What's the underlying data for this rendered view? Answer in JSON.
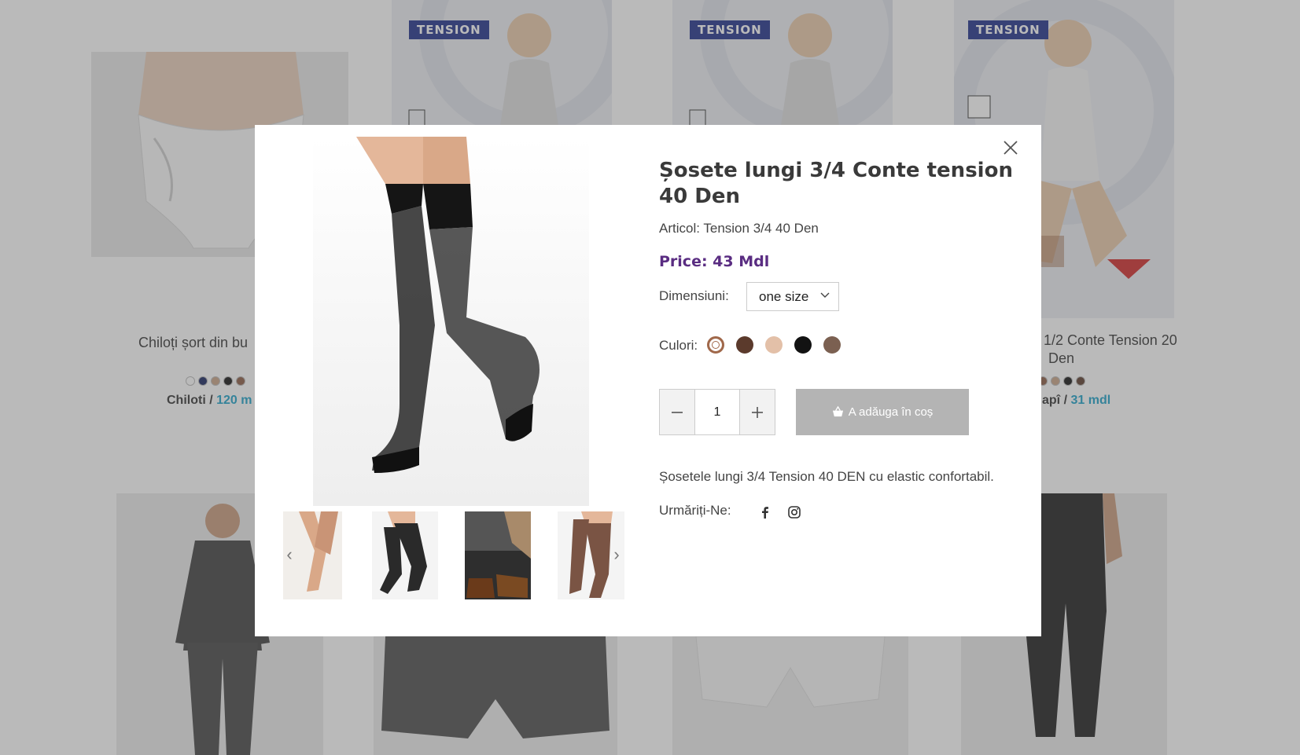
{
  "background": {
    "products": [
      {
        "title": "Chiloți șort din bu",
        "category": "Chiloti",
        "price": "120 m",
        "swatch_colors": [
          "#ffffff",
          "#16245e",
          "#c8a285",
          "#111111",
          "#8a5a42"
        ]
      },
      {
        "title": "1/2 Conte Tension 20",
        "title_line2": "Den",
        "category": "apî",
        "price": "31 mdl",
        "swatch_colors": [
          "#8a5a42",
          "#c8a285",
          "#111111",
          "#5a3a2a"
        ]
      }
    ],
    "brand_tag": "TENSION"
  },
  "modal": {
    "close_label": "×",
    "product": {
      "title": "Șosete lungi 3/4 Conte tension 40 Den",
      "article": "Articol: Tension 3/4 40 Den",
      "price": "Price: 43 Mdl",
      "size_label": "Dimensiuni:",
      "size_value": "one size",
      "colors_label": "Culori:",
      "colors": [
        "#c79476",
        "#5b3a2c",
        "#e3c0a8",
        "#121212",
        "#7b6051"
      ],
      "selected_color_index": 0,
      "quantity": "1",
      "add_to_cart": "A adăuga în coș",
      "description": "Șosetele lungi 3/4 Tension 40 DEN cu elastic confortabil.",
      "follow_label": "Urmăriți-Ne:"
    },
    "icons": {
      "close": "close-icon",
      "basket": "basket-icon",
      "facebook": "facebook-icon",
      "instagram": "instagram-icon",
      "prev": "chevron-left-icon",
      "next": "chevron-right-icon",
      "dropdown": "chevron-down-icon"
    },
    "colors": {
      "price": "#5a2d82",
      "button_bg": "#b4b4b4",
      "overlay": "rgba(90,90,90,0.42)"
    }
  }
}
